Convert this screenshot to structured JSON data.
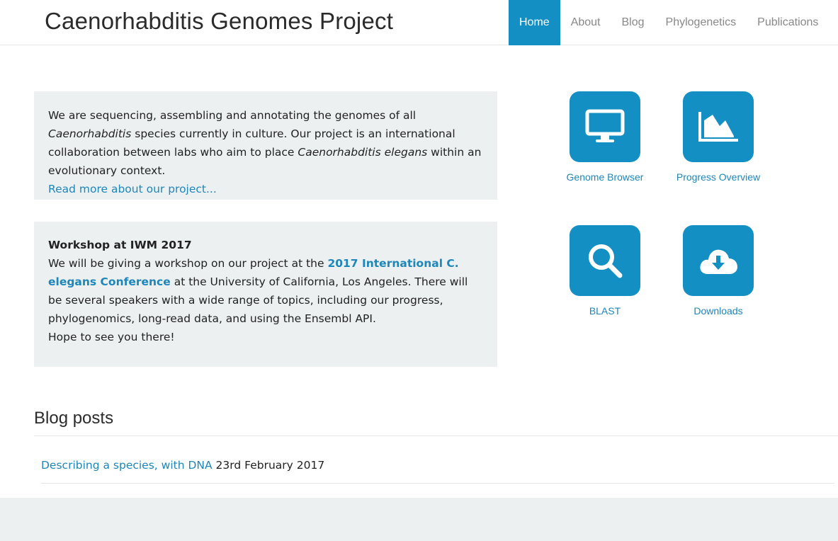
{
  "header": {
    "title": "Caenorhabditis Genomes Project",
    "nav": [
      {
        "label": "Home",
        "active": true
      },
      {
        "label": "About",
        "active": false
      },
      {
        "label": "Blog",
        "active": false
      },
      {
        "label": "Phylogenetics",
        "active": false
      },
      {
        "label": "Publications",
        "active": false
      }
    ]
  },
  "intro": {
    "text_1": "We are sequencing, assembling and annotating the genomes of all ",
    "genus": "Caenorhabditis",
    "text_2": " species currently in culture. Our project is an international collaboration between labs who aim to place ",
    "species": "Caenorhabditis elegans",
    "text_3": " within an evolutionary context.",
    "read_more": "Read more about our project..."
  },
  "workshop": {
    "title": "Workshop at IWM 2017",
    "text_1": "We will be giving a workshop on our project at the ",
    "conference_link": "2017 International C. elegans Conference",
    "text_2": " at the University of California, Los Angeles. There will be several speakers with a wide range of topics, including our progress, phylogenomics, long-read data, and using the Ensembl API.",
    "text_3": "Hope to see you there!"
  },
  "tiles": [
    {
      "label": "Genome Browser",
      "icon": "monitor-icon"
    },
    {
      "label": "Progress Overview",
      "icon": "area-chart-icon"
    },
    {
      "label": "BLAST",
      "icon": "search-icon"
    },
    {
      "label": "Downloads",
      "icon": "cloud-download-icon"
    }
  ],
  "blog": {
    "heading": "Blog posts",
    "posts": [
      {
        "title": "Describing a species, with DNA",
        "date": "23rd February 2017"
      }
    ]
  },
  "colors": {
    "accent": "#138fc3",
    "link": "#1e86b8",
    "panel_bg": "#ecf0f1"
  }
}
